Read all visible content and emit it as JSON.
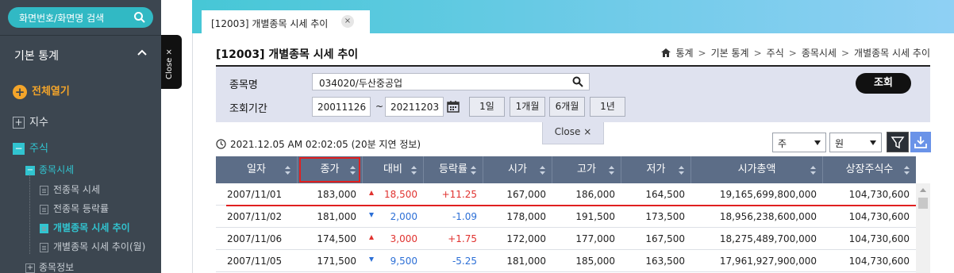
{
  "sidebar": {
    "search_placeholder": "화면번호/화면명 검색",
    "section_title": "기본 통계",
    "expand_all": "전체열기",
    "close_tab": "Close ×",
    "items": {
      "index": "지수",
      "stock": "주식",
      "stock_price": "종목시세",
      "stock_info": "종목정보"
    },
    "sub_items": [
      "전종목 시세",
      "전종목 등락률",
      "개별종목 시세 추이",
      "개별종목 시세 추이(월)"
    ],
    "active_sub": "개별종목 시세 추이"
  },
  "tab": {
    "label": "[12003] 개별종목 시세 추이",
    "close": "×"
  },
  "page": {
    "title": "[12003] 개별종목 시세 추이",
    "breadcrumb": [
      "통계",
      "기본 통계",
      "주식",
      "종목시세",
      "개별종목 시세 추이"
    ],
    "breadcrumb_sep": ">"
  },
  "filter": {
    "code_label": "종목명",
    "code_value": "034020/두산중공업",
    "period_label": "조회기간",
    "start_date": "20011126",
    "tilde": "~",
    "end_date": "20211203",
    "period_buttons": [
      "1일",
      "1개월",
      "6개월",
      "1년"
    ],
    "query_button": "조회",
    "close_label": "Close ×"
  },
  "toolbar": {
    "timestamp": "2021.12.05 AM 02:02:05",
    "delay_note": "(20분 지연 정보)",
    "period_select": "주",
    "unit_select": "원"
  },
  "table": {
    "headers": [
      "일자",
      "종가",
      "대비",
      "등락률",
      "시가",
      "고가",
      "저가",
      "시가총액",
      "상장주식수"
    ],
    "highlighted_header": "종가",
    "rows": [
      {
        "date": "2007/11/01",
        "close": "183,000",
        "dir": "up",
        "change": "18,500",
        "rate": "+11.25",
        "open": "167,000",
        "high": "186,000",
        "low": "164,500",
        "mktcap": "19,165,699,800,000",
        "shares": "104,730,600"
      },
      {
        "date": "2007/11/02",
        "close": "181,000",
        "dir": "down",
        "change": "2,000",
        "rate": "-1.09",
        "open": "178,000",
        "high": "191,500",
        "low": "173,500",
        "mktcap": "18,956,238,600,000",
        "shares": "104,730,600"
      },
      {
        "date": "2007/11/06",
        "close": "174,500",
        "dir": "up",
        "change": "3,000",
        "rate": "+1.75",
        "open": "172,000",
        "high": "177,000",
        "low": "167,500",
        "mktcap": "18,275,489,700,000",
        "shares": "104,730,600"
      },
      {
        "date": "2007/11/05",
        "close": "171,500",
        "dir": "down",
        "change": "9,500",
        "rate": "-5.25",
        "open": "181,000",
        "high": "185,000",
        "low": "163,500",
        "mktcap": "17,961,927,900,000",
        "shares": "104,730,600"
      }
    ]
  },
  "colors": {
    "up": "#e0322f",
    "down": "#2c6fd6",
    "accent": "#31b9c4",
    "header": "#5c6d87"
  }
}
